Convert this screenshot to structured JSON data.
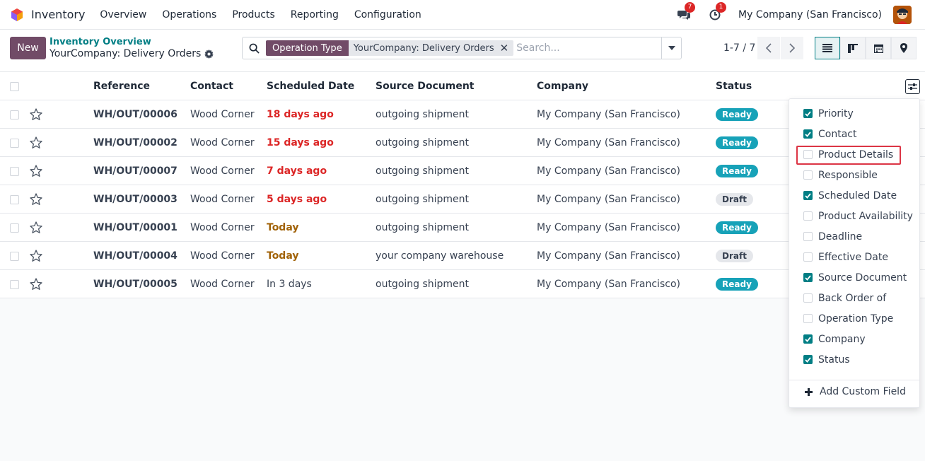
{
  "navbar": {
    "app_name": "Inventory",
    "menu": [
      "Overview",
      "Operations",
      "Products",
      "Reporting",
      "Configuration"
    ],
    "messages_count": "7",
    "activities_count": "1",
    "company": "My Company (San Francisco)"
  },
  "control": {
    "new_label": "New",
    "breadcrumb": "Inventory Overview",
    "title": "YourCompany: Delivery Orders",
    "facet_label": "Operation Type",
    "facet_value": "YourCompany: Delivery Orders",
    "search_placeholder": "Search...",
    "pager": "1-7 / 7"
  },
  "list": {
    "columns": [
      "Reference",
      "Contact",
      "Scheduled Date",
      "Source Document",
      "Company",
      "Status"
    ],
    "rows": [
      {
        "reference": "WH/OUT/00006",
        "contact": "Wood Corner",
        "date": "18 days ago",
        "date_state": "overdue",
        "source": "outgoing shipment",
        "company": "My Company (San Francisco)",
        "status": "Ready"
      },
      {
        "reference": "WH/OUT/00002",
        "contact": "Wood Corner",
        "date": "15 days ago",
        "date_state": "overdue",
        "source": "outgoing shipment",
        "company": "My Company (San Francisco)",
        "status": "Ready"
      },
      {
        "reference": "WH/OUT/00007",
        "contact": "Wood Corner",
        "date": "7 days ago",
        "date_state": "overdue",
        "source": "outgoing shipment",
        "company": "My Company (San Francisco)",
        "status": "Ready"
      },
      {
        "reference": "WH/OUT/00003",
        "contact": "Wood Corner",
        "date": "5 days ago",
        "date_state": "overdue",
        "source": "outgoing shipment",
        "company": "My Company (San Francisco)",
        "status": "Draft"
      },
      {
        "reference": "WH/OUT/00001",
        "contact": "Wood Corner",
        "date": "Today",
        "date_state": "today",
        "source": "outgoing shipment",
        "company": "My Company (San Francisco)",
        "status": "Ready"
      },
      {
        "reference": "WH/OUT/00004",
        "contact": "Wood Corner",
        "date": "Today",
        "date_state": "today",
        "source": "your company warehouse",
        "company": "My Company (San Francisco)",
        "status": "Draft"
      },
      {
        "reference": "WH/OUT/00005",
        "contact": "Wood Corner",
        "date": "In 3 days",
        "date_state": "future",
        "source": "outgoing shipment",
        "company": "My Company (San Francisco)",
        "status": "Ready"
      }
    ]
  },
  "column_menu": {
    "options": [
      {
        "label": "Priority",
        "checked": true
      },
      {
        "label": "Contact",
        "checked": true
      },
      {
        "label": "Product Details",
        "checked": false
      },
      {
        "label": "Responsible",
        "checked": false
      },
      {
        "label": "Scheduled Date",
        "checked": true
      },
      {
        "label": "Product Availability",
        "checked": false
      },
      {
        "label": "Deadline",
        "checked": false
      },
      {
        "label": "Effective Date",
        "checked": false
      },
      {
        "label": "Source Document",
        "checked": true
      },
      {
        "label": "Back Order of",
        "checked": false
      },
      {
        "label": "Operation Type",
        "checked": false
      },
      {
        "label": "Company",
        "checked": true
      },
      {
        "label": "Status",
        "checked": true
      }
    ],
    "add_custom_field": "Add Custom Field"
  },
  "colors": {
    "brand": "#714b67",
    "accent": "#017e84",
    "overdue": "#dc2626",
    "today": "#a16207",
    "ready": "#17a2b8"
  }
}
